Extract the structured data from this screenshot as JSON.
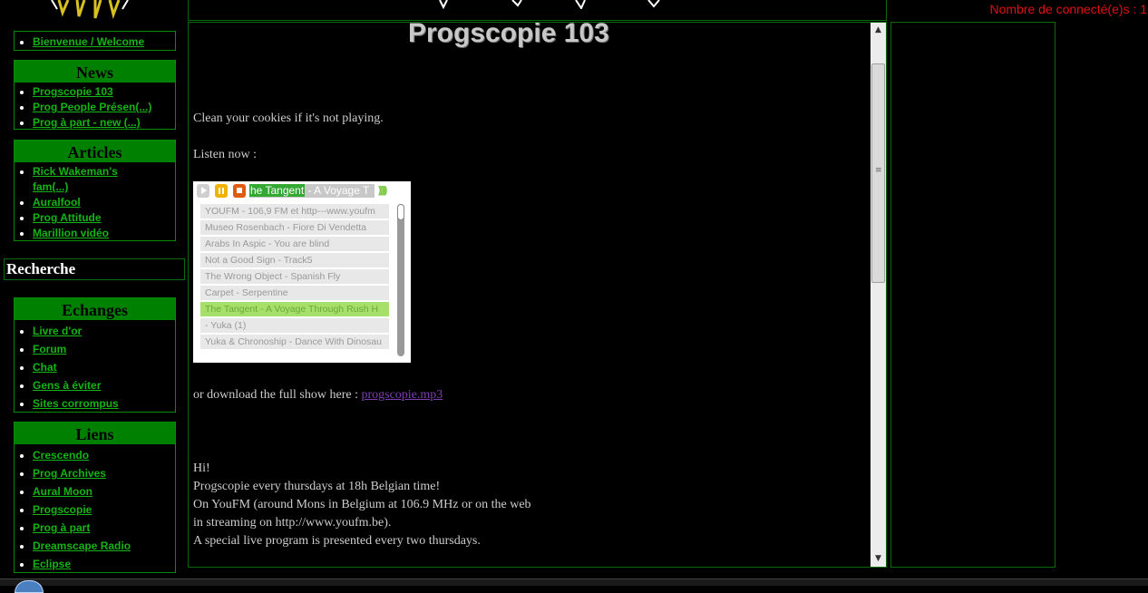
{
  "header": {
    "connected_text": "Nombre de connecté(e)s : 1"
  },
  "sidebar": {
    "welcome": {
      "items": [
        {
          "label": "Bienvenue / Welcome"
        }
      ]
    },
    "news": {
      "title": "News",
      "items": [
        {
          "label": "Progscopie 103"
        },
        {
          "label": "Prog People Présen(...)"
        },
        {
          "label": "Prog à part - new (...)"
        }
      ]
    },
    "articles": {
      "title": "Articles",
      "items": [
        {
          "label": "Rick Wakeman's fam(...)"
        },
        {
          "label": "Auralfool"
        },
        {
          "label": "Prog Attitude"
        },
        {
          "label": "Marillion vidéo"
        }
      ]
    },
    "search": {
      "title": "Recherche"
    },
    "echanges": {
      "title": "Echanges",
      "items": [
        {
          "label": "Livre d'or"
        },
        {
          "label": "Forum"
        },
        {
          "label": "Chat"
        },
        {
          "label": "Gens à éviter"
        },
        {
          "label": "Sites corrompus"
        }
      ]
    },
    "liens": {
      "title": "Liens",
      "items": [
        {
          "label": "Crescendo"
        },
        {
          "label": "Prog Archives"
        },
        {
          "label": "Aural Moon"
        },
        {
          "label": "Progscopie"
        },
        {
          "label": "Prog à part"
        },
        {
          "label": "Dreamscape Radio"
        },
        {
          "label": "Eclipse"
        }
      ]
    }
  },
  "main": {
    "title": "Progscopie 103",
    "cookies_text": "Clean your cookies if it's not playing.",
    "listen_text": "Listen now :",
    "player": {
      "now_playing_prefix": "he Tangent",
      "now_playing_rest": " - A Voyage T",
      "volume_glyph": ")))))",
      "tracks": [
        {
          "label": "YOUFM - 106,9 FM et http---www.youfm",
          "active": false
        },
        {
          "label": "Museo Rosenbach - Fiore Di Vendetta",
          "active": false
        },
        {
          "label": "Arabs In Aspic - You are blind",
          "active": false
        },
        {
          "label": "Not a Good Sign - Track5",
          "active": false
        },
        {
          "label": "The Wrong Object - Spanish Fly",
          "active": false
        },
        {
          "label": "Carpet - Serpentine",
          "active": false
        },
        {
          "label": "The Tangent - A Voyage Through Rush H",
          "active": true
        },
        {
          "label": " - Yuka (1)",
          "active": false
        },
        {
          "label": "Yuka & Chronoship - Dance With Dinosau",
          "active": false
        }
      ]
    },
    "download_prefix": "or download the full show here : ",
    "download_link": "progscopie.mp3",
    "body_lines": [
      "Hi!",
      "Progscopie every thursdays at 18h Belgian time!",
      "On YouFM (around Mons in Belgium at 106.9 MHz or on the web",
      "in streaming on http://www.youfm.be).",
      "A special live program is presented every two thursdays."
    ]
  },
  "colors": {
    "accent_green": "#008000",
    "link_green": "#14b414",
    "alert_red": "#e01010",
    "visited_link": "#7d3fb0"
  }
}
